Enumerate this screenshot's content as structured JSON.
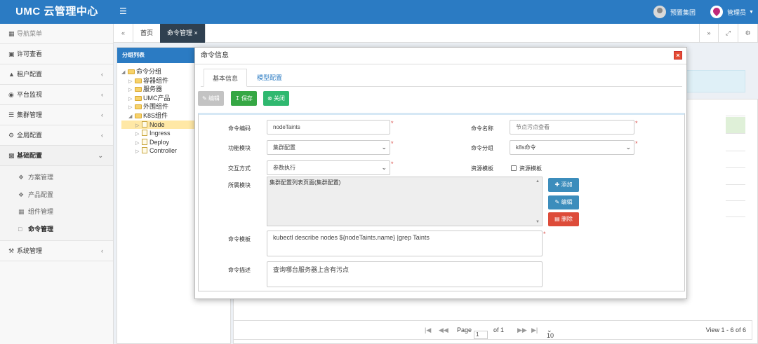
{
  "app": {
    "title": "UMC 云管理中心"
  },
  "header": {
    "org": "预置集团",
    "user": "管理员"
  },
  "sidebar": {
    "items": [
      {
        "label": "导航菜单"
      },
      {
        "label": "许可查看"
      },
      {
        "label": "租户配置"
      },
      {
        "label": "平台监视"
      },
      {
        "label": "集群管理"
      },
      {
        "label": "全局配置"
      },
      {
        "label": "基础配置"
      },
      {
        "label": "系统管理"
      }
    ],
    "sub": [
      {
        "label": "方案管理"
      },
      {
        "label": "产品配置"
      },
      {
        "label": "组件管理"
      },
      {
        "label": "命令管理"
      }
    ]
  },
  "tabs": {
    "home": "首页",
    "active": "命令管理"
  },
  "tree": {
    "title": "分组列表",
    "nodes": [
      {
        "label": "命令分组"
      },
      {
        "label": "容器组件"
      },
      {
        "label": "服务器"
      },
      {
        "label": "UMC产品"
      },
      {
        "label": "外围组件"
      },
      {
        "label": "K8S组件"
      },
      {
        "label": "Node"
      },
      {
        "label": "Ingress"
      },
      {
        "label": "Deploy"
      },
      {
        "label": "Controller"
      }
    ]
  },
  "pager": {
    "page_label": "Page",
    "page_value": "1",
    "of_label": "of 1",
    "page_size": "10",
    "view": "View 1 - 6 of 6"
  },
  "modal": {
    "title": "命令信息",
    "tabs": [
      "基本信息",
      "模型配置"
    ],
    "buttons": {
      "edit": "编辑",
      "save": "保存",
      "close": "关闭"
    },
    "form": {
      "code_label": "命令编码",
      "code_value": "nodeTaints",
      "name_label": "命令名称",
      "name_placeholder": "节点污点查看",
      "module_label": "功能模块",
      "module_value": "集群配置",
      "group_label": "命令分组",
      "group_value": "k8s命令",
      "mode_label": "交互方式",
      "mode_value": "参数执行",
      "res_label": "资源模板",
      "res_check_label": "资源模板",
      "owner_label": "所属模块",
      "owner_value": "集群配置列表页面(集群配置)",
      "add_btn": "添加",
      "edit_btn": "编辑",
      "del_btn": "删除",
      "tpl_label": "命令模板",
      "tpl_value": "kubectl describe nodes ${nodeTaints.name} |grep Taints",
      "desc_label": "命令描述",
      "desc_value": "查询哪台服务器上含有污点"
    }
  }
}
